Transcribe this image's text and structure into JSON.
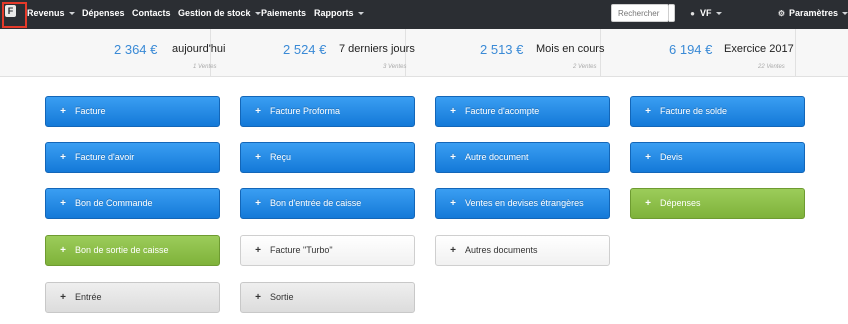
{
  "nav": {
    "logo": "F",
    "items": [
      {
        "label": "Revenus",
        "caret": true
      },
      {
        "label": "Dépenses",
        "caret": false
      },
      {
        "label": "Contacts",
        "caret": false
      },
      {
        "label": "Gestion de stock",
        "caret": true
      },
      {
        "label": "Paiements",
        "caret": false
      },
      {
        "label": "Rapports",
        "caret": true
      }
    ],
    "search_placeholder": "Rechercher",
    "user_label": "VF",
    "user_icon": "users-icon",
    "settings_label": "Paramètres",
    "settings_icon": "gear-icon",
    "accent_color": "#e53a2a"
  },
  "stats": [
    {
      "amount": "2 364 €",
      "label": "aujourd'hui",
      "sub": "1 Ventes"
    },
    {
      "amount": "2 524 €",
      "label": "7 derniers jours",
      "sub": "3 Ventes"
    },
    {
      "amount": "2 513 €",
      "label": "Mois en cours",
      "sub": "2 Ventes"
    },
    {
      "amount": "6 194 €",
      "label": "Exercice 2017",
      "sub": "22 Ventes"
    }
  ],
  "actions": {
    "plus": "+",
    "facture": "Facture",
    "facture_proforma": "Facture Proforma",
    "facture_acompte": "Facture d'acompte",
    "facture_solde": "Facture de solde",
    "facture_avoir": "Facture d'avoir",
    "recu": "Reçu",
    "autre_document": "Autre document",
    "devis": "Devis",
    "bon_commande": "Bon de Commande",
    "bon_entree_caisse": "Bon d'entrée de caisse",
    "ventes_devises": "Ventes en devises étrangères",
    "depenses": "Dépenses",
    "bon_sortie_caisse": "Bon de sortie de caisse",
    "facture_turbo": "Facture \"Turbo\"",
    "autres_documents": "Autres documents",
    "entree": "Entrée",
    "sortie": "Sortie"
  },
  "colors": {
    "topbar": "#2b2e33",
    "blue": "#1f86e0",
    "green": "#8bbd47",
    "amount": "#3a8ad6"
  }
}
